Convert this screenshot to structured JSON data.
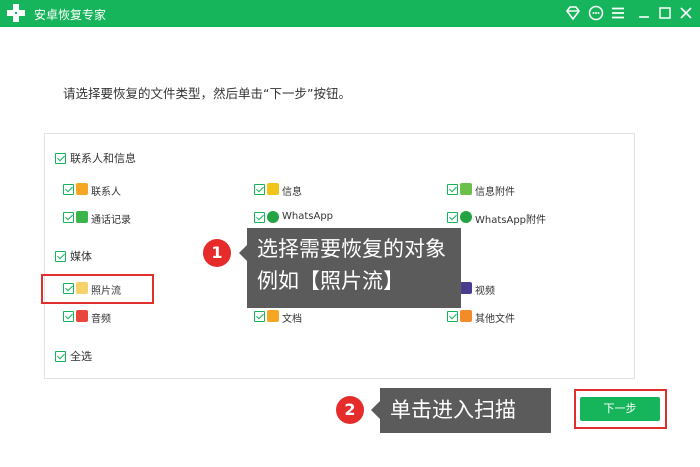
{
  "app": {
    "title": "安卓恢复专家"
  },
  "instruction": "请选择要恢复的文件类型，然后单击“下一步”按钮。",
  "groups": {
    "contacts": {
      "label": "联系人和信息",
      "items": [
        "联系人",
        "信息",
        "信息附件",
        "通话记录",
        "WhatsApp",
        "WhatsApp附件"
      ]
    },
    "media": {
      "label": "媒体",
      "items": [
        "照片流",
        "视频",
        "音频",
        "文档",
        "其他文件"
      ]
    },
    "select_all": "全选"
  },
  "callouts": {
    "step1_badge": "1",
    "step1_line1": "选择需要恢复的对象",
    "step1_line2": "例如【照片流】",
    "step2_badge": "2",
    "step2_text": "单击进入扫描"
  },
  "buttons": {
    "next": "下一步"
  },
  "icons": {
    "logo": "plus-cross-logo",
    "titlebar": [
      "diamond-icon",
      "chat-icon",
      "menu-icon",
      "minimize-icon",
      "maximize-icon",
      "close-icon"
    ]
  },
  "colors": {
    "brand_green": "#17b55b",
    "highlight_red": "#e0302e",
    "callout_bg": "#5b5b5b"
  }
}
